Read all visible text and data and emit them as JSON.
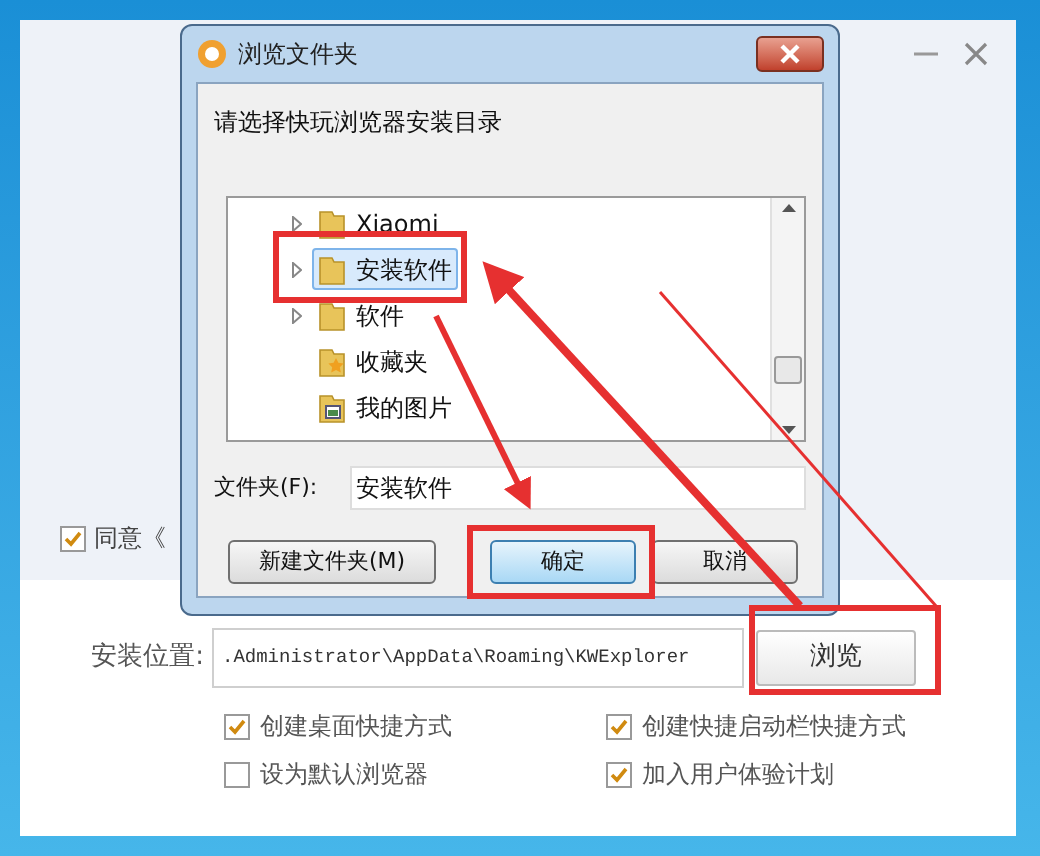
{
  "agreement": {
    "checked": true,
    "label": "同意《"
  },
  "dialog": {
    "title": "浏览文件夹",
    "prompt": "请选择快玩浏览器安装目录",
    "tree": [
      {
        "label": "Xiaomi",
        "kind": "folder",
        "expandable": true,
        "selected": false
      },
      {
        "label": "安装软件",
        "kind": "folder",
        "expandable": true,
        "selected": true
      },
      {
        "label": "软件",
        "kind": "folder",
        "expandable": true,
        "selected": false
      },
      {
        "label": "收藏夹",
        "kind": "favorites",
        "expandable": false,
        "selected": false
      },
      {
        "label": "我的图片",
        "kind": "pictures",
        "expandable": false,
        "selected": false
      }
    ],
    "folder_label": "文件夹(F):",
    "folder_value": "安装软件",
    "buttons": [
      {
        "label": "新建文件夹(M)",
        "default": false
      },
      {
        "label": "确定",
        "default": true
      },
      {
        "label": "取消",
        "default": false
      }
    ]
  },
  "install": {
    "label": "安装位置:",
    "path": ".Administrator\\AppData\\Roaming\\KWExplorer",
    "browse": "浏览"
  },
  "options": [
    {
      "label": "创建桌面快捷方式",
      "checked": true
    },
    {
      "label": "创建快捷启动栏快捷方式",
      "checked": true
    },
    {
      "label": "设为默认浏览器",
      "checked": false
    },
    {
      "label": "加入用户体验计划",
      "checked": true
    }
  ]
}
